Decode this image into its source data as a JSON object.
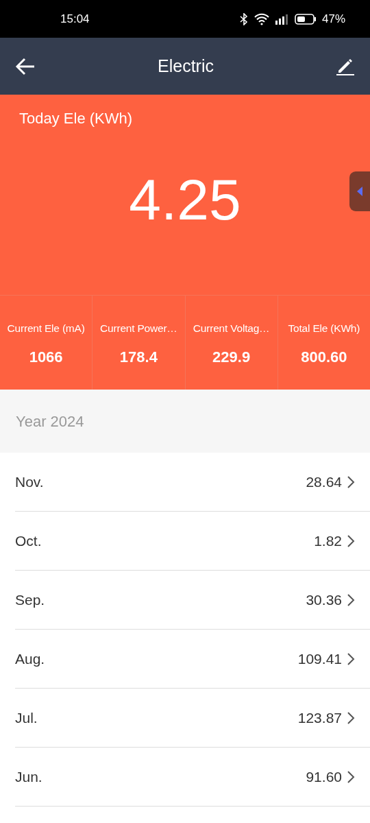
{
  "status_bar": {
    "time": "15:04",
    "battery": "47%"
  },
  "header": {
    "title": "Electric"
  },
  "today": {
    "label": "Today Ele (KWh)",
    "value": "4.25"
  },
  "stats": [
    {
      "label": "Current Ele (mA)",
      "value": "1066"
    },
    {
      "label": "Current Power…",
      "value": "178.4"
    },
    {
      "label": "Current Voltag…",
      "value": "229.9"
    },
    {
      "label": "Total Ele (KWh)",
      "value": "800.60"
    }
  ],
  "year": "Year 2024",
  "months": [
    {
      "name": "Nov.",
      "value": "28.64"
    },
    {
      "name": "Oct.",
      "value": "1.82"
    },
    {
      "name": "Sep.",
      "value": "30.36"
    },
    {
      "name": "Aug.",
      "value": "109.41"
    },
    {
      "name": "Jul.",
      "value": "123.87"
    },
    {
      "name": "Jun.",
      "value": "91.60"
    }
  ]
}
